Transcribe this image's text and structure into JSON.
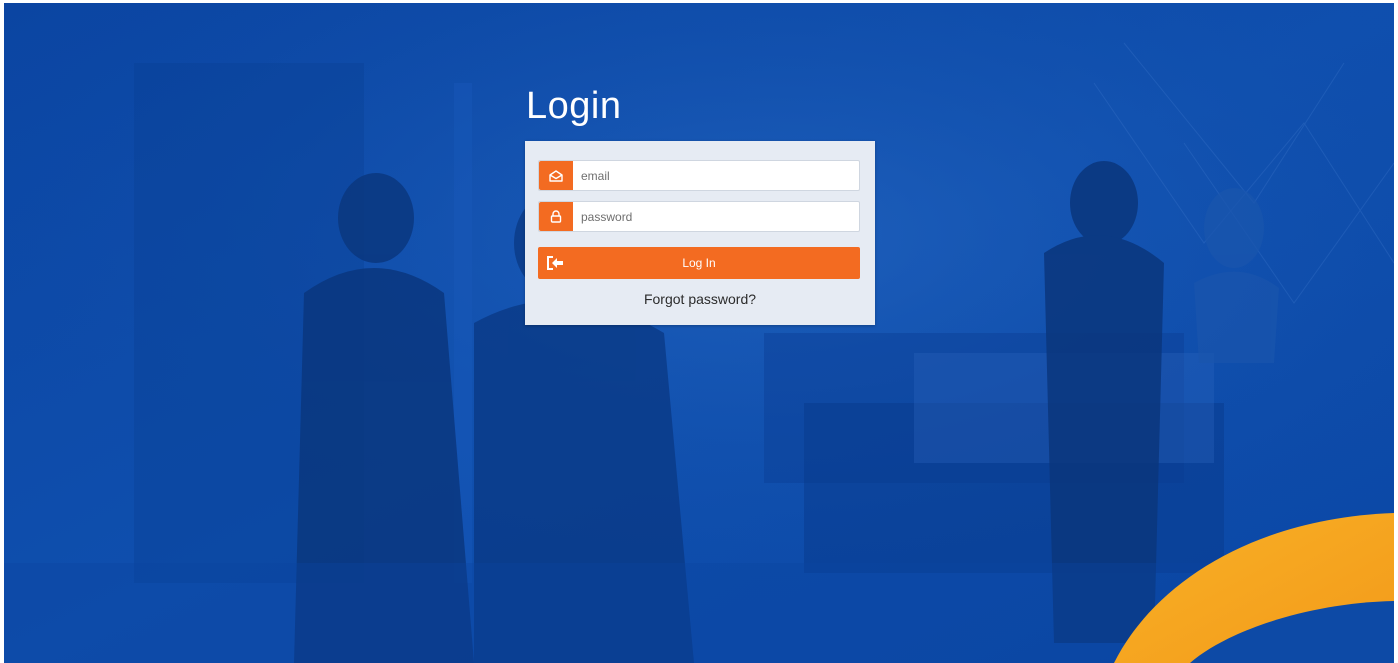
{
  "title": "Login",
  "form": {
    "email_placeholder": "email",
    "password_placeholder": "password",
    "login_label": "Log In",
    "forgot_label": "Forgot password?"
  },
  "colors": {
    "background": "#0d4aa6",
    "accent": "#f36b21",
    "card": "#e6ebf3",
    "arc": "#f7a21b"
  },
  "icons": {
    "email": "envelope-icon",
    "password": "lock-icon",
    "login": "sign-in-icon"
  }
}
